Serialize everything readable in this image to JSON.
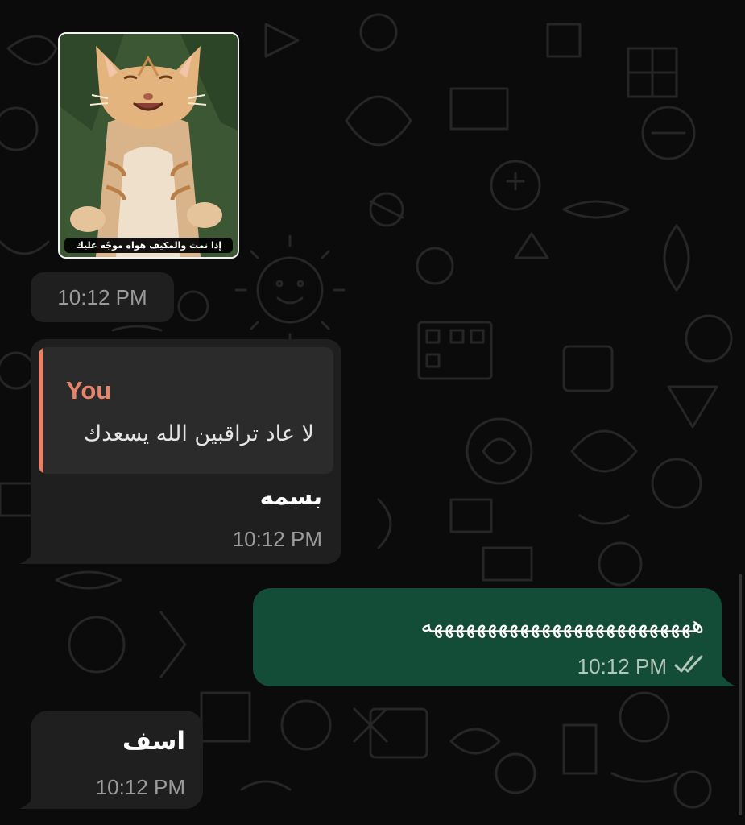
{
  "chat": {
    "sticker": {
      "caption": "إذا نمت والمكيف هواه موجّه عليك",
      "time": "10:12 PM"
    },
    "reply_message": {
      "quoted_author": "You",
      "quoted_text": "لا عاد تراقبين الله يسعدك",
      "text": "بسمه",
      "time": "10:12 PM"
    },
    "outgoing_message": {
      "text": "هههههههههههههههههههههههههه",
      "time": "10:12 PM",
      "status_icon": "double-check-icon"
    },
    "last_message": {
      "text": "اسف",
      "time": "10:12 PM"
    }
  },
  "colors": {
    "background": "#0b0b0b",
    "incoming_bubble": "#1f1f1f",
    "outgoing_bubble": "#144d37",
    "quote_accent": "#e8836c"
  }
}
